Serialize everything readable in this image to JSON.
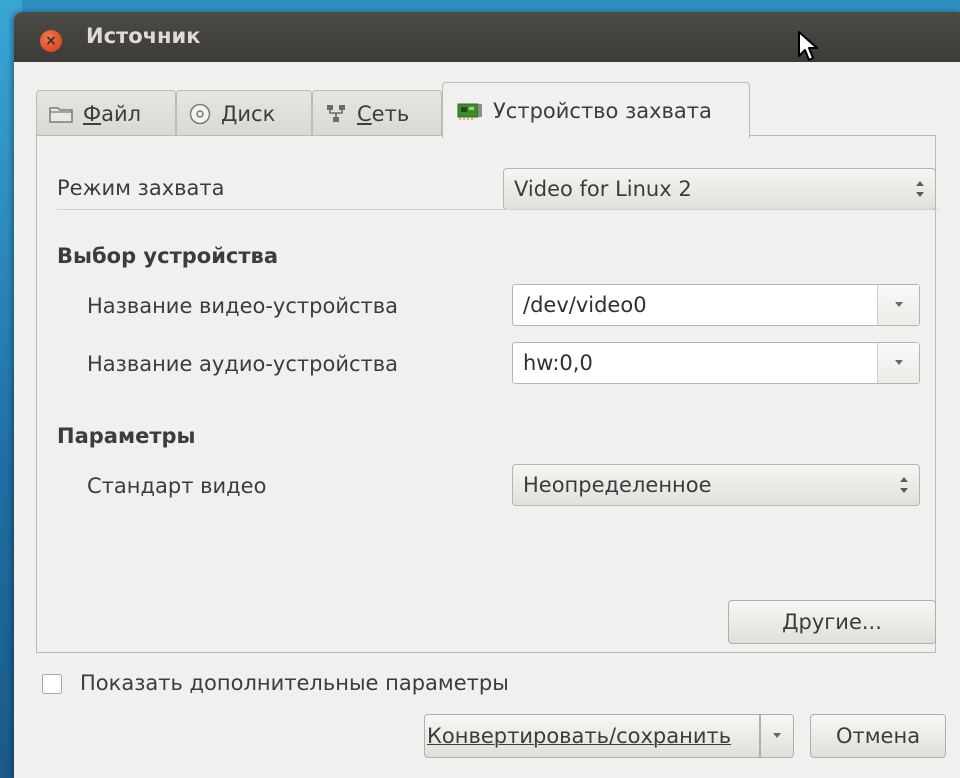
{
  "window": {
    "title": "Источник",
    "close_symbol": "×"
  },
  "tabs": [
    {
      "label": "Файл",
      "icon": "folder-icon"
    },
    {
      "label": "Диск",
      "icon": "disc-icon"
    },
    {
      "label": "Сеть",
      "icon": "network-icon"
    },
    {
      "label": "Устройство захвата",
      "icon": "capture-card-icon",
      "active": true
    }
  ],
  "capture": {
    "mode_label": "Режим захвата",
    "mode_value": "Video for Linux 2"
  },
  "device_section": {
    "title": "Выбор устройства",
    "video_label": "Название видео-устройства",
    "video_value": "/dev/video0",
    "audio_label": "Название аудио-устройства",
    "audio_value": "hw:0,0"
  },
  "params_section": {
    "title": "Параметры",
    "standard_label": "Стандарт видео",
    "standard_value": "Неопределенное"
  },
  "other_button": "Другие...",
  "show_more": {
    "label": "Показать дополнительные параметры",
    "checked": false
  },
  "footer": {
    "convert_label": "Конвертировать/сохранить",
    "cancel_label": "Отмена"
  },
  "colors": {
    "titlebar": "#3c3b37",
    "window_bg": "#f1f0ee",
    "close_button": "#e0512a",
    "desktop": "#2f8fc0"
  }
}
